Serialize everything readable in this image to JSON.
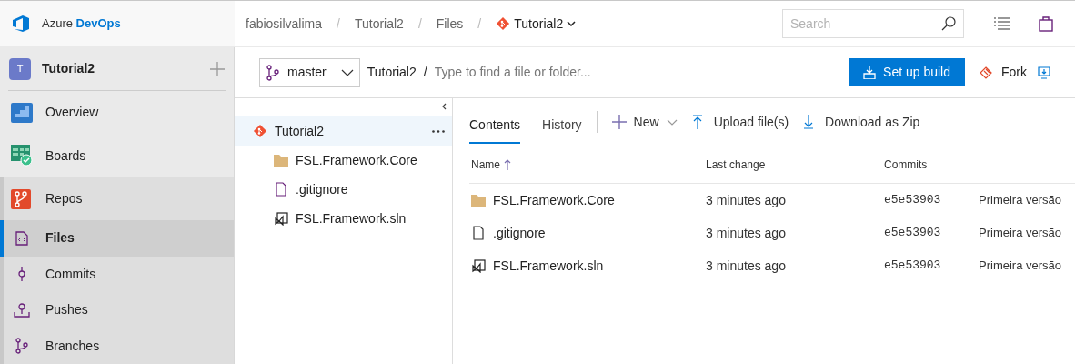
{
  "brand": {
    "name": "Azure",
    "product": "DevOps"
  },
  "breadcrumb": [
    "fabiosilvalima",
    "Tutorial2",
    "Files"
  ],
  "breadcrumb_separator": "/",
  "breadcrumb_repo": "Tutorial2",
  "search": {
    "placeholder": "Search"
  },
  "project": {
    "initial": "T",
    "name": "Tutorial2"
  },
  "nav": [
    {
      "label": "Overview",
      "kind": "hub",
      "selected": false
    },
    {
      "label": "Boards",
      "kind": "hub",
      "selected": false
    },
    {
      "label": "Repos",
      "kind": "hub",
      "selected": true
    },
    {
      "label": "Files",
      "kind": "sub",
      "selected": true
    },
    {
      "label": "Commits",
      "kind": "sub",
      "selected": false
    },
    {
      "label": "Pushes",
      "kind": "sub",
      "selected": false
    },
    {
      "label": "Branches",
      "kind": "sub",
      "selected": false
    }
  ],
  "branch": "master",
  "path_root": "Tutorial2",
  "path_separator": "/",
  "path_placeholder": "Type to find a file or folder...",
  "setup_build": "Set up build",
  "fork": "Fork",
  "tree": {
    "name": "Tutorial2",
    "selected": true,
    "children": [
      {
        "name": "FSL.Framework.Core",
        "kind": "folder"
      },
      {
        "name": ".gitignore",
        "kind": "file"
      },
      {
        "name": "FSL.Framework.sln",
        "kind": "sln"
      }
    ]
  },
  "tabs": [
    {
      "label": "Contents",
      "selected": true
    },
    {
      "label": "History",
      "selected": false
    }
  ],
  "actions": {
    "new": "New",
    "upload": "Upload file(s)",
    "download": "Download as Zip"
  },
  "table": {
    "columns": [
      "Name",
      "Last change",
      "Commits"
    ],
    "rows": [
      {
        "name": "FSL.Framework.Core",
        "kind": "folder",
        "last_change": "3 minutes ago",
        "commit": "e5e53903",
        "message": "Primeira versão"
      },
      {
        "name": ".gitignore",
        "kind": "file",
        "last_change": "3 minutes ago",
        "commit": "e5e53903",
        "message": "Primeira versão"
      },
      {
        "name": "FSL.Framework.sln",
        "kind": "sln",
        "last_change": "3 minutes ago",
        "commit": "e5e53903",
        "message": "Primeira versão"
      }
    ]
  }
}
